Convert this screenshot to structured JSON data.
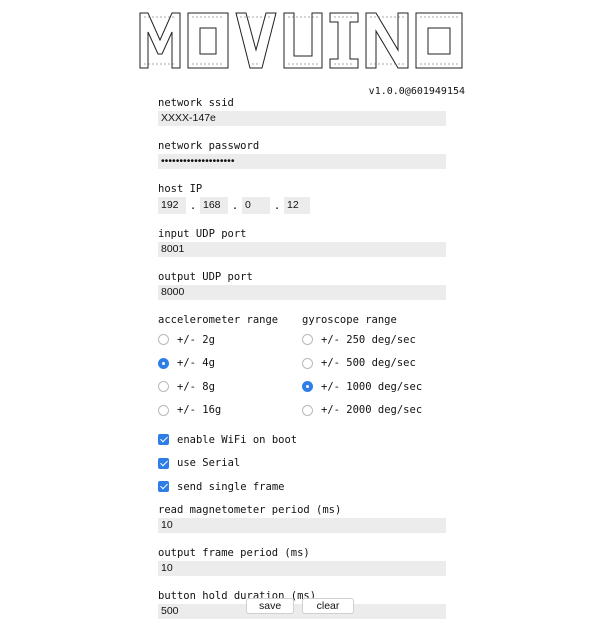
{
  "app": {
    "logo_text": "MOVUINO",
    "version": "v1.0.0@601949154"
  },
  "fields": {
    "network_ssid": {
      "label": "network ssid",
      "value": "XXXX-147e"
    },
    "network_password": {
      "label": "network password",
      "value": "••••••••••••••••••••"
    },
    "host_ip": {
      "label": "host IP",
      "octets": [
        "192",
        "168",
        "0",
        "12"
      ],
      "separator": "."
    },
    "input_udp_port": {
      "label": "input UDP port",
      "value": "8001"
    },
    "output_udp_port": {
      "label": "output UDP port",
      "value": "8000"
    }
  },
  "accelerometer": {
    "label": "accelerometer range",
    "options": [
      "+/- 2g",
      "+/- 4g",
      "+/- 8g",
      "+/- 16g"
    ],
    "selected": 1
  },
  "gyroscope": {
    "label": "gyroscope range",
    "options": [
      "+/- 250 deg/sec",
      "+/- 500 deg/sec",
      "+/- 1000 deg/sec",
      "+/- 2000 deg/sec"
    ],
    "selected": 2
  },
  "checkboxes": [
    {
      "label": "enable WiFi on boot",
      "checked": true
    },
    {
      "label": "use Serial",
      "checked": true
    },
    {
      "label": "send single frame",
      "checked": true
    }
  ],
  "periods": {
    "read_magnetometer": {
      "label": "read magnetometer period (ms)",
      "value": "10"
    },
    "output_frame": {
      "label": "output frame period (ms)",
      "value": "10"
    },
    "button_hold": {
      "label": "button hold duration (ms)",
      "value": "500"
    }
  },
  "buttons": {
    "save": "save",
    "clear": "clear"
  },
  "colors": {
    "accent": "#2f7ee8",
    "field_bg": "#ececec"
  }
}
